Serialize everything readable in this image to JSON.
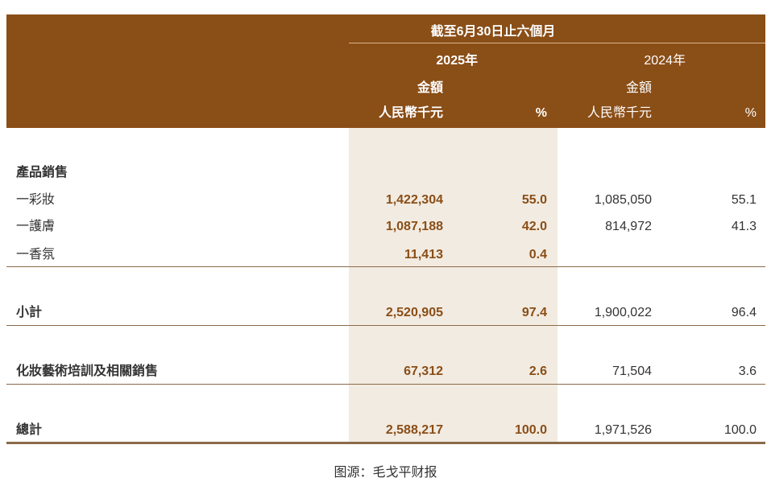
{
  "header": {
    "period": "截至6月30日止六個月",
    "year_2025": "2025年",
    "year_2024": "2024年",
    "amount_2025": "金額",
    "amount_2024": "金額",
    "unit_2025": "人民幣千元",
    "pct_2025": "%",
    "unit_2024": "人民幣千元",
    "pct_2024": "%"
  },
  "section_title": "產品銷售",
  "rows": [
    {
      "label": "一彩妝",
      "amt_2025": "1,422,304",
      "pct_2025": "55.0",
      "amt_2024": "1,085,050",
      "pct_2024": "55.1"
    },
    {
      "label": "一護膚",
      "amt_2025": "1,087,188",
      "pct_2025": "42.0",
      "amt_2024": "814,972",
      "pct_2024": "41.3"
    },
    {
      "label": "一香氛",
      "amt_2025": "11,413",
      "pct_2025": "0.4",
      "amt_2024": "",
      "pct_2024": ""
    },
    {
      "label": "小計",
      "amt_2025": "2,520,905",
      "pct_2025": "97.4",
      "amt_2024": "1,900,022",
      "pct_2024": "96.4"
    },
    {
      "label": "化妝藝術培訓及相關銷售",
      "amt_2025": "67,312",
      "pct_2025": "2.6",
      "amt_2024": "71,504",
      "pct_2024": "3.6"
    },
    {
      "label": "總計",
      "amt_2025": "2,588,217",
      "pct_2025": "100.0",
      "amt_2024": "1,971,526",
      "pct_2024": "100.0"
    }
  ],
  "source": "图源：毛戈平财报",
  "colors": {
    "header_bg": "#8a4e17",
    "highlight_col": "#f2ebe1",
    "accent_text": "#8a4e17"
  }
}
